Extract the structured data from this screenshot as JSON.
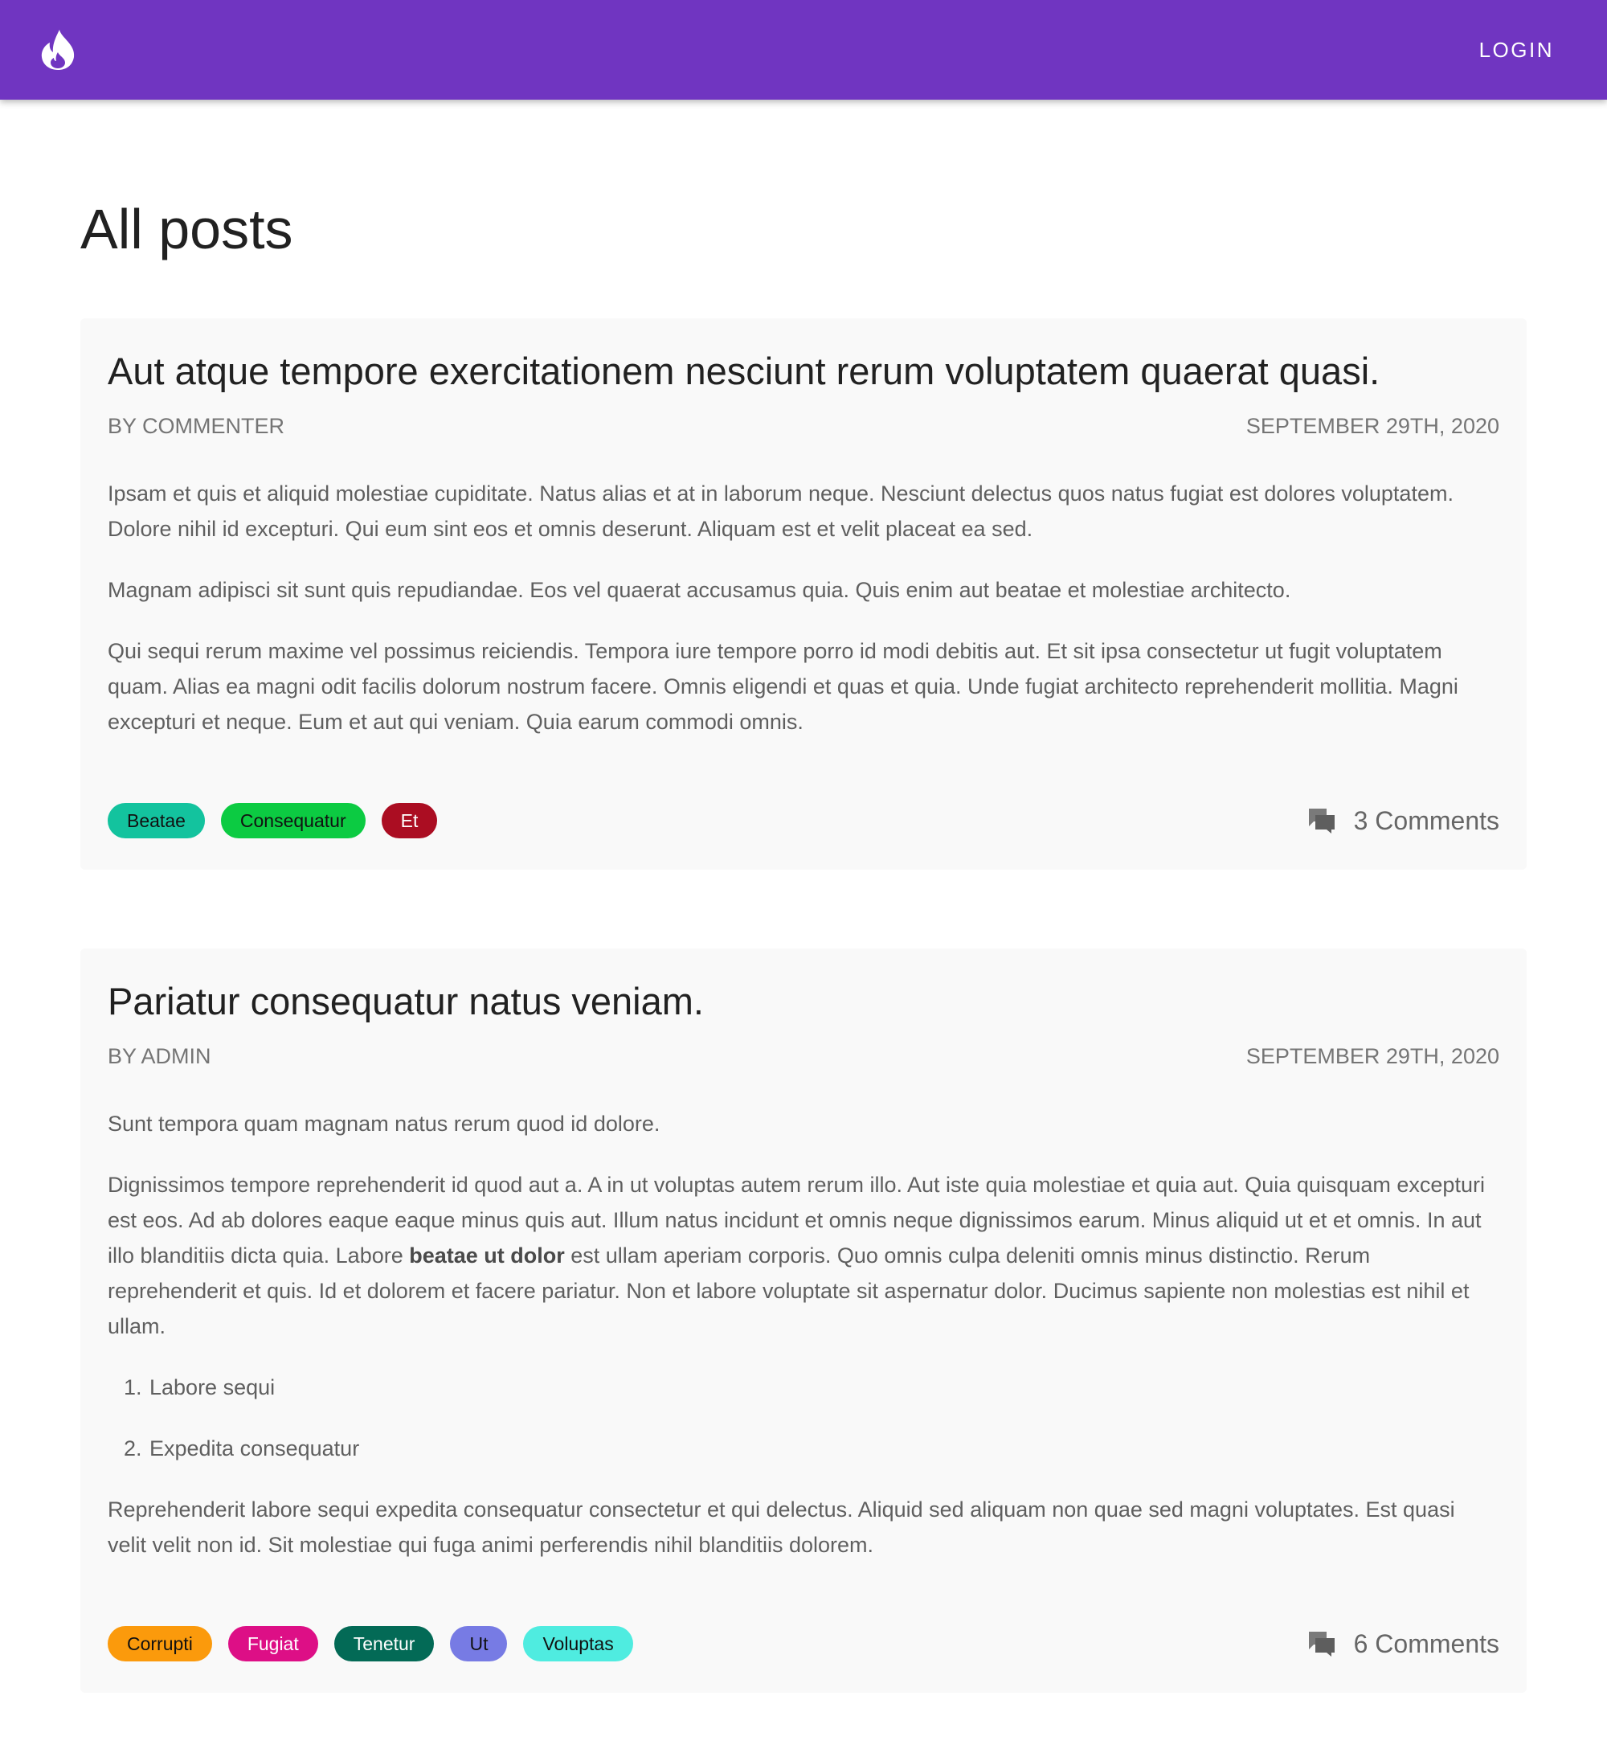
{
  "appbar": {
    "background": "#7035c1",
    "logo_icon": "flame-icon",
    "login_label": "LOGIN"
  },
  "page": {
    "title": "All posts"
  },
  "posts": [
    {
      "title": "Aut atque tempore exercitationem nesciunt rerum voluptatem quaerat quasi.",
      "author": "By commenter",
      "date": "September 29th, 2020",
      "paragraphs": [
        "Ipsam et quis et aliquid molestiae cupiditate. Natus alias et at in laborum neque. Nesciunt delectus quos natus fugiat est dolores voluptatem. Dolore nihil id excepturi. Qui eum sint eos et omnis deserunt. Aliquam est et velit placeat ea sed.",
        "Magnam adipisci sit sunt quis repudiandae. Eos vel quaerat accusamus quia. Quis enim aut beatae et molestiae architecto.",
        "Qui sequi rerum maxime vel possimus reiciendis. Tempora iure tempore porro id modi debitis aut. Et sit ipsa consectetur ut fugit voluptatem quam. Alias ea magni odit facilis dolorum nostrum facere. Omnis eligendi et quas et quia. Unde fugiat architecto reprehenderit mollitia. Magni excepturi et neque. Eum et aut qui veniam. Quia earum commodi omnis."
      ],
      "tags": [
        {
          "label": "Beatae",
          "bg": "#13c39e",
          "color": "#111111"
        },
        {
          "label": "Consequatur",
          "bg": "#0ccb42",
          "color": "#111111"
        },
        {
          "label": "Et",
          "bg": "#ab0d22",
          "color": "#ffffff"
        }
      ],
      "comments_label": "3 Comments",
      "comments_icon": "comments-icon"
    },
    {
      "title": "Pariatur consequatur natus veniam.",
      "author": "By admin",
      "date": "September 29th, 2020",
      "p1": "Sunt tempora quam magnam natus rerum quod id dolore.",
      "p2_before": "Dignissimos tempore reprehenderit id quod aut a. A in ut voluptas autem rerum illo. Aut iste quia molestiae et quia aut. Quia quisquam excepturi est eos. Ad ab dolores eaque eaque minus quis aut. Illum natus incidunt et omnis neque dignissimos earum. Minus aliquid ut et et omnis. In aut illo blanditiis dicta quia. Labore ",
      "p2_bold": "beatae ut dolor",
      "p2_after": " est ullam aperiam corporis. Quo omnis culpa deleniti omnis minus distinctio. Rerum reprehenderit et quis. Id et dolorem et facere pariatur. Non et labore voluptate sit aspernatur dolor. Ducimus sapiente non molestias est nihil et ullam.",
      "list": [
        "Labore sequi",
        "Expedita consequatur"
      ],
      "p3": "Reprehenderit labore sequi expedita consequatur consectetur et qui delectus. Aliquid sed aliquam non quae sed magni voluptates. Est quasi velit velit non id. Sit molestiae qui fuga animi perferendis nihil blanditiis dolorem.",
      "tags": [
        {
          "label": "Corrupti",
          "bg": "#fb9a0c",
          "color": "#111111"
        },
        {
          "label": "Fugiat",
          "bg": "#dd0f86",
          "color": "#ffffff"
        },
        {
          "label": "Tenetur",
          "bg": "#036a56",
          "color": "#ffffff"
        },
        {
          "label": "Ut",
          "bg": "#777be4",
          "color": "#111111"
        },
        {
          "label": "Voluptas",
          "bg": "#4fece0",
          "color": "#111111"
        }
      ],
      "comments_label": "6 Comments",
      "comments_icon": "comments-icon"
    }
  ]
}
